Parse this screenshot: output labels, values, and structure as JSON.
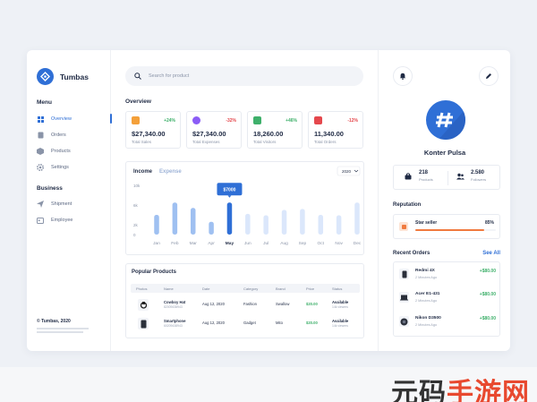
{
  "brand": {
    "name": "Tumbas"
  },
  "sidebar": {
    "menu_title": "Menu",
    "menu_items": [
      {
        "label": "Overview",
        "icon": "grid-icon",
        "active": true
      },
      {
        "label": "Orders",
        "icon": "document-icon",
        "active": false
      },
      {
        "label": "Products",
        "icon": "box-icon",
        "active": false
      },
      {
        "label": "Settings",
        "icon": "gear-icon",
        "active": false
      }
    ],
    "business_title": "Business",
    "business_items": [
      {
        "label": "Shipment",
        "icon": "send-icon"
      },
      {
        "label": "Employee",
        "icon": "id-card-icon"
      }
    ],
    "footer": {
      "title": "© Tumbas, 2020"
    }
  },
  "search": {
    "placeholder": "Search for product"
  },
  "overview": {
    "title": "Overview",
    "stats": [
      {
        "value": "$27,340.00",
        "label": "Total Sales",
        "change": "+24%",
        "change_color": "#3fb06b",
        "icon_color": "#f4a03a"
      },
      {
        "value": "$27,340.00",
        "label": "Total Expenses",
        "change": "-32%",
        "change_color": "#e5484d",
        "icon_color": "#8b5cf6"
      },
      {
        "value": "18,260.00",
        "label": "Total Visitors",
        "change": "+46%",
        "change_color": "#3fb06b",
        "icon_color": "#3fb06b"
      },
      {
        "value": "11,340.00",
        "label": "Total Orders",
        "change": "-12%",
        "change_color": "#e5484d",
        "icon_color": "#e5484d"
      }
    ]
  },
  "chart": {
    "tab_income": "Income",
    "tab_expense": "Expense",
    "year": "2020",
    "tooltip": "$7000"
  },
  "chart_data": {
    "type": "bar",
    "categories": [
      "Jan",
      "Feb",
      "Mar",
      "Apr",
      "May",
      "Jun",
      "Jul",
      "Aug",
      "Sep",
      "Oct",
      "Nov",
      "Dec"
    ],
    "values": [
      4000,
      6500,
      5400,
      2600,
      6500,
      4200,
      3900,
      5000,
      5200,
      4000,
      3900,
      6500
    ],
    "highlight_index": 4,
    "ylim": [
      0,
      10000
    ],
    "yticks": [
      "0",
      "2k",
      "6k",
      "10k"
    ],
    "ytick_values": [
      0,
      2000,
      6000,
      10000
    ],
    "bar_color": "#dbe7fb",
    "bar_color_partial": "#9fc0f1",
    "highlight_color": "#2f6fd6"
  },
  "popular": {
    "title": "Popular Products",
    "columns": [
      "Photos",
      "Name",
      "Date",
      "Category",
      "Brand",
      "Price",
      "Status"
    ],
    "rows": [
      {
        "name": "Cowboy Hat",
        "sku": "82009438943",
        "date": "Aug 12, 2020",
        "category": "Fashion",
        "brand": "Swallow",
        "price": "$20.00",
        "status": "Available",
        "status_sub": "14k viewers"
      },
      {
        "name": "Smartphone",
        "sku": "60209438943",
        "date": "Aug 12, 2020",
        "category": "Gadget",
        "brand": "Mito",
        "price": "$20.00",
        "status": "Available",
        "status_sub": "14k viewers"
      }
    ]
  },
  "profile": {
    "name": "Konter Pulsa",
    "products_count": "218",
    "products_label": "Products",
    "followers_count": "2.580",
    "followers_label": "Followers"
  },
  "reputation": {
    "title": "Reputation",
    "label": "Star seller",
    "percent_text": "85%",
    "percent": 85
  },
  "orders": {
    "title": "Recent Orders",
    "see_all": "See All",
    "items": [
      {
        "name": "Redmi 4X",
        "time": "2 Minutes Ago",
        "price": "+$80.00"
      },
      {
        "name": "Acer E1-431",
        "time": "2 Minutes Ago",
        "price": "+$80.00"
      },
      {
        "name": "Nikon D3500",
        "time": "2 Minutes Ago",
        "price": "+$80.00"
      }
    ]
  },
  "watermark": {
    "text_a": "元码",
    "text_b": "手游网"
  }
}
